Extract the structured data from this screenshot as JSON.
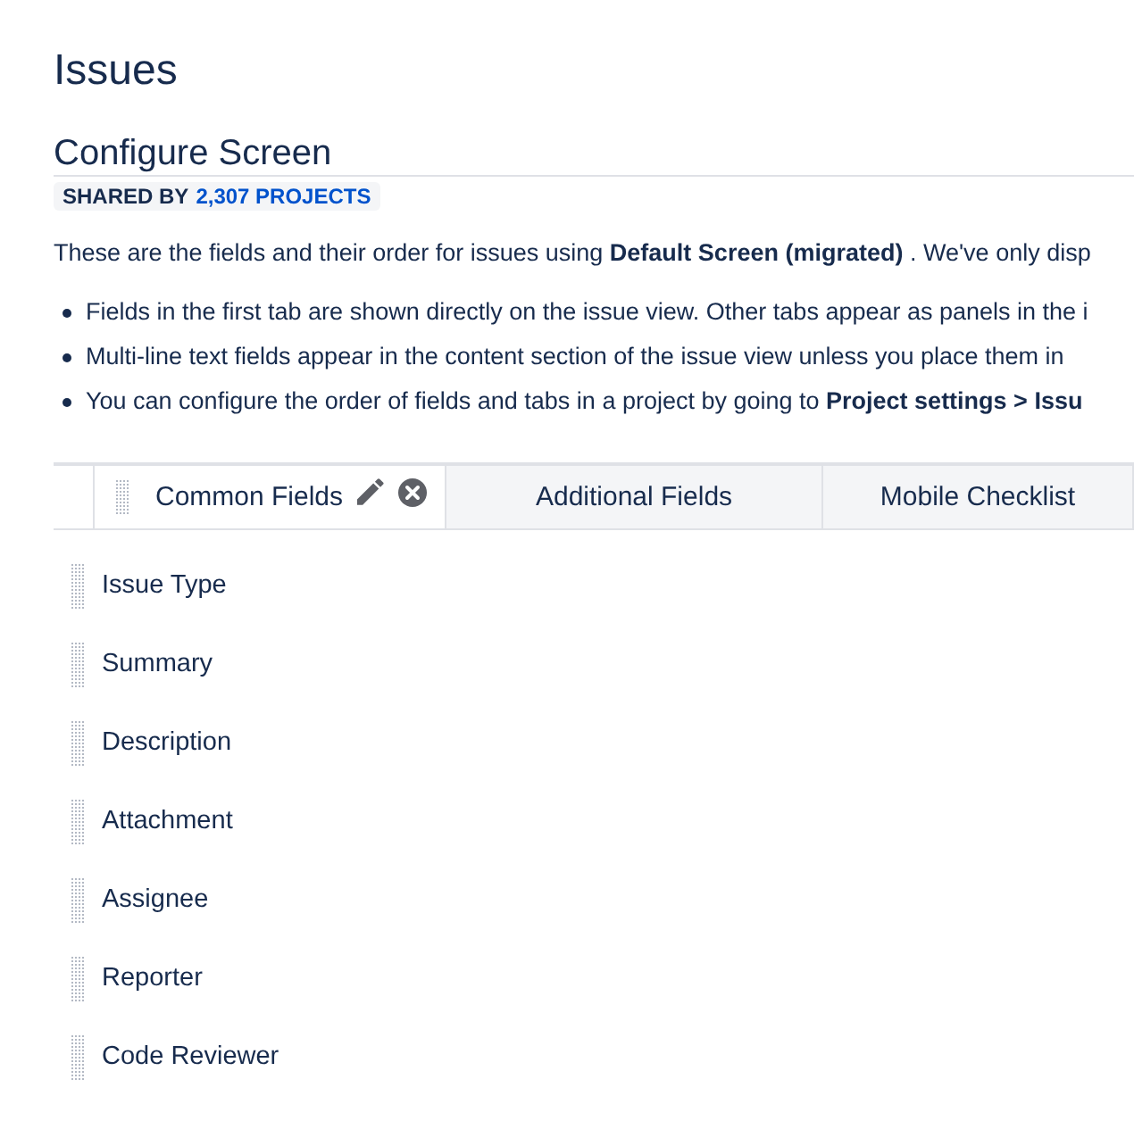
{
  "page": {
    "title": "Issues"
  },
  "screen": {
    "title": "Configure Screen",
    "shared_label": "SHARED BY",
    "shared_link": "2,307 PROJECTS"
  },
  "intro": "These are the fields and their order for issues using **Default Screen (migrated)** . We've only disp",
  "notes": [
    "Fields in the first tab are shown directly on the issue view. Other tabs appear as panels in the i",
    "Multi-line text fields appear in the content section of the issue view unless you place them in",
    "You can configure the order of fields and tabs in a project by going to **Project settings > Issu**"
  ],
  "tabs": [
    {
      "label": "Common Fields",
      "selected": true
    },
    {
      "label": "Additional Fields",
      "selected": false
    },
    {
      "label": "Mobile Checklist",
      "selected": false
    }
  ],
  "fields": [
    "Issue Type",
    "Summary",
    "Description",
    "Attachment",
    "Assignee",
    "Reporter",
    "Code Reviewer"
  ]
}
